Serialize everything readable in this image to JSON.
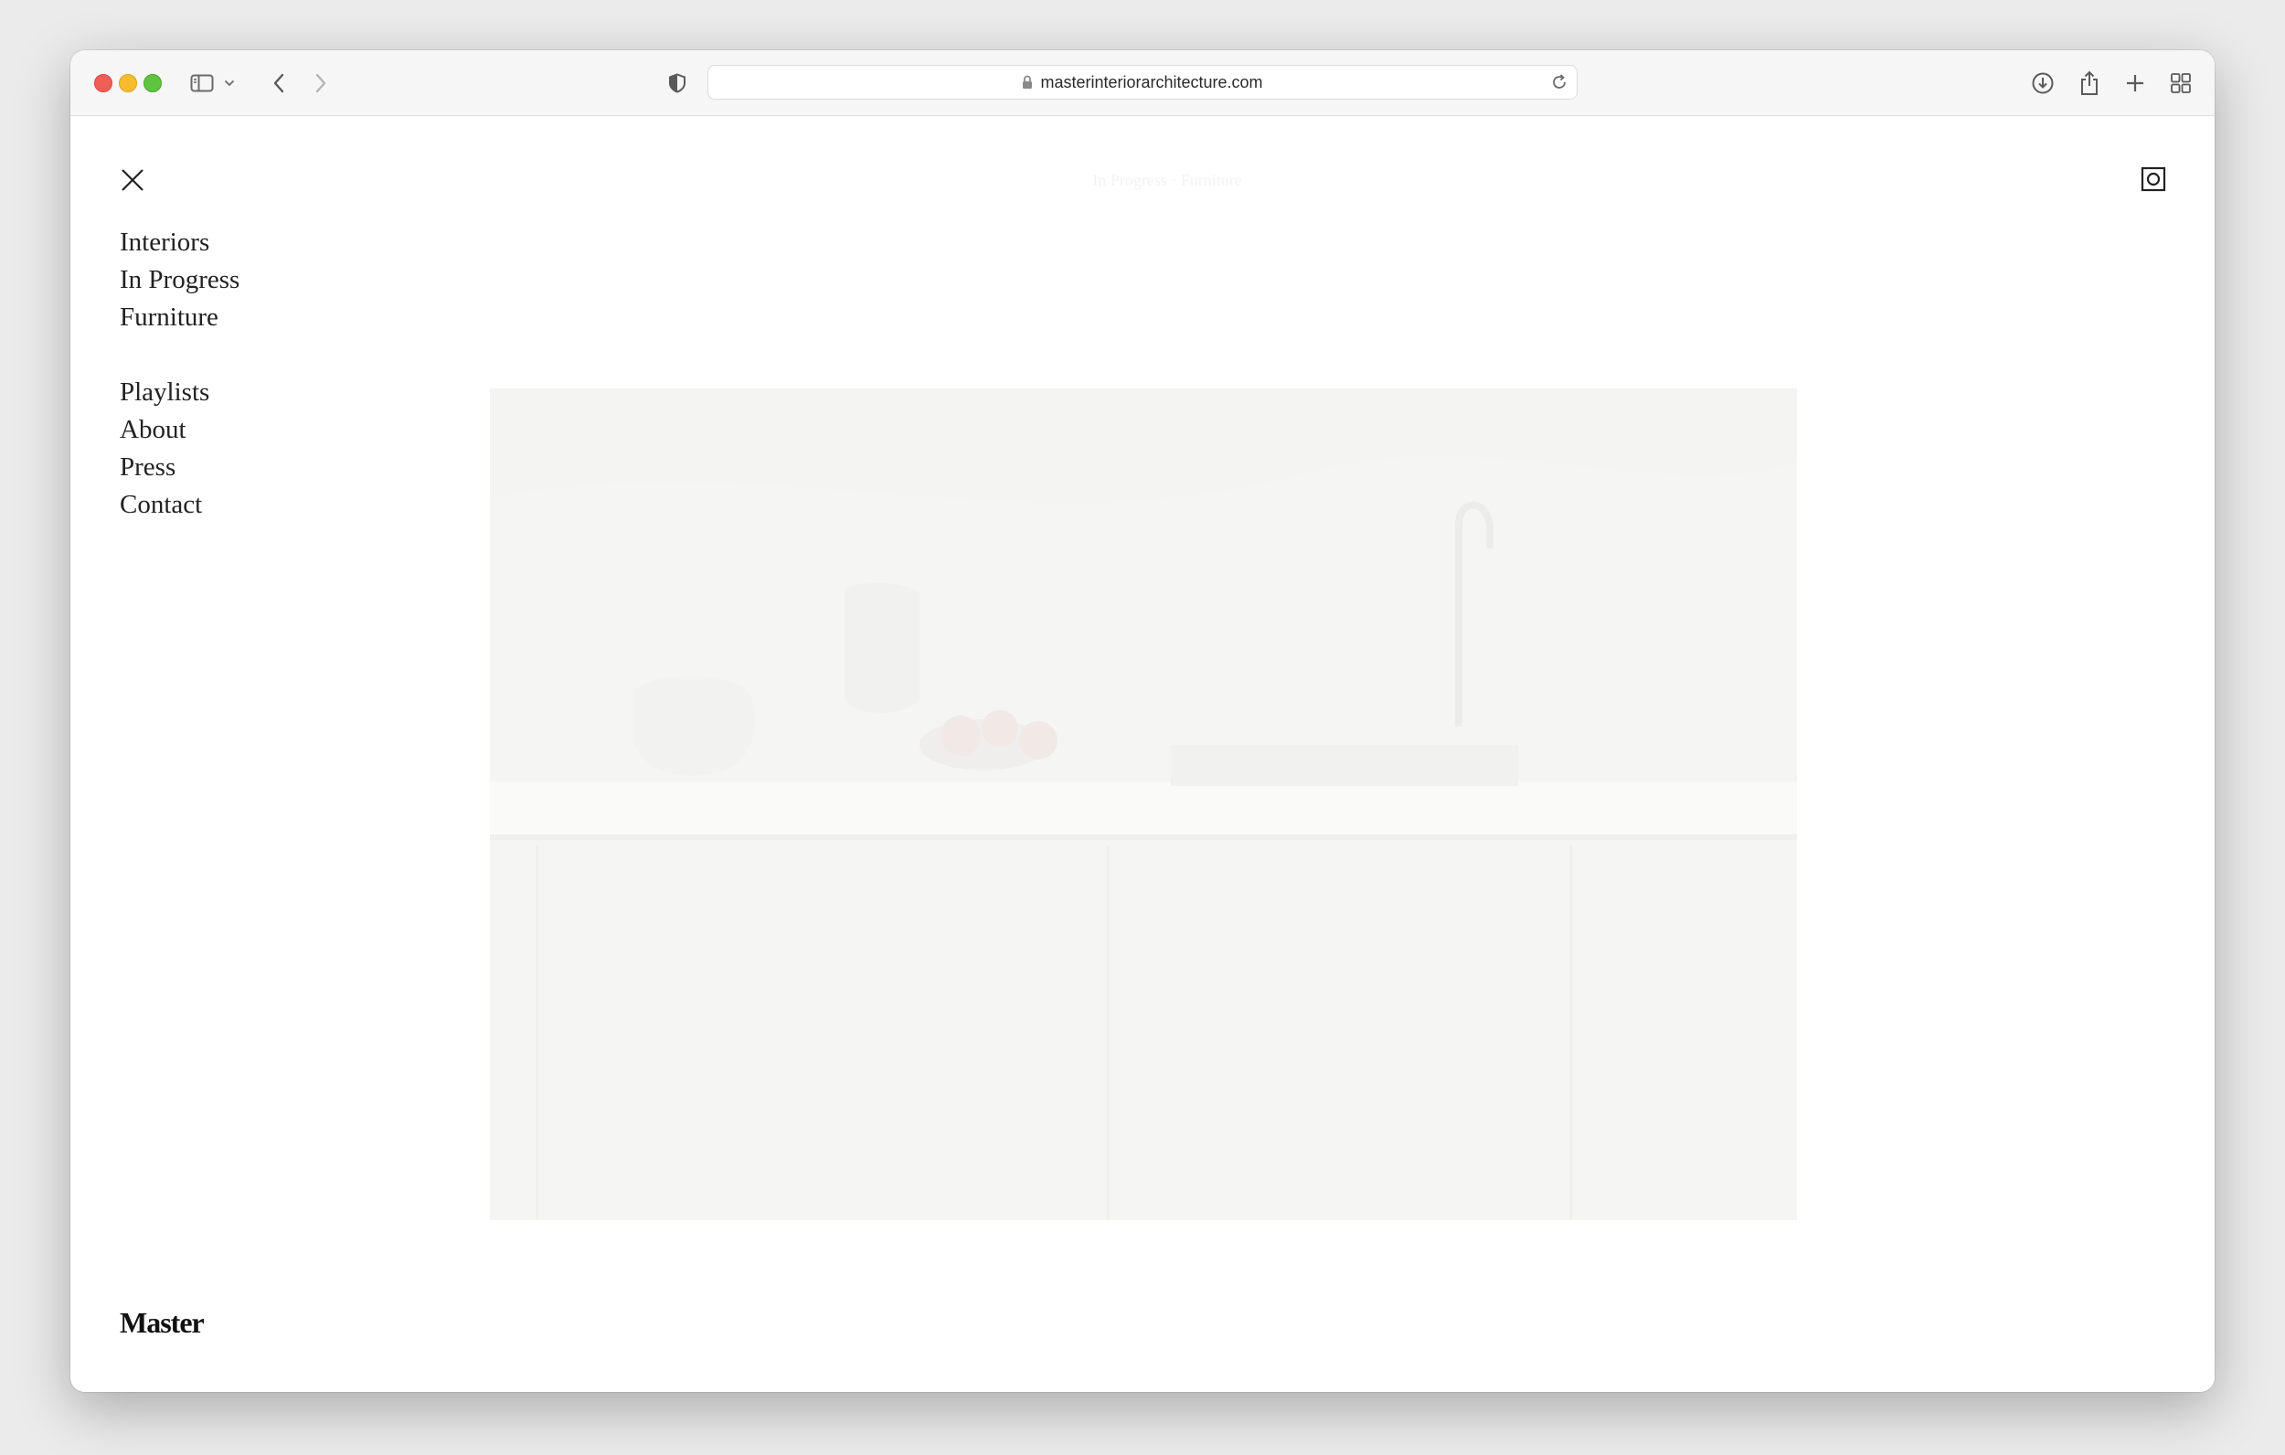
{
  "browser": {
    "url": "masterinteriorarchitecture.com",
    "colors": {
      "close": "#ee5f57",
      "minimize": "#f5bd2e",
      "zoom": "#5fc440"
    },
    "icons": [
      "sidebar-icon",
      "chevron-down-icon",
      "back-icon",
      "forward-icon",
      "shield-icon",
      "lock-icon",
      "reload-icon",
      "download-icon",
      "share-icon",
      "new-tab-icon",
      "tab-overview-icon"
    ]
  },
  "site": {
    "breadcrumb": "In Progress · Furniture",
    "menu_primary": [
      "Interiors",
      "In Progress",
      "Furniture"
    ],
    "menu_secondary": [
      "Playlists",
      "About",
      "Press",
      "Contact"
    ],
    "brand": "Master"
  }
}
